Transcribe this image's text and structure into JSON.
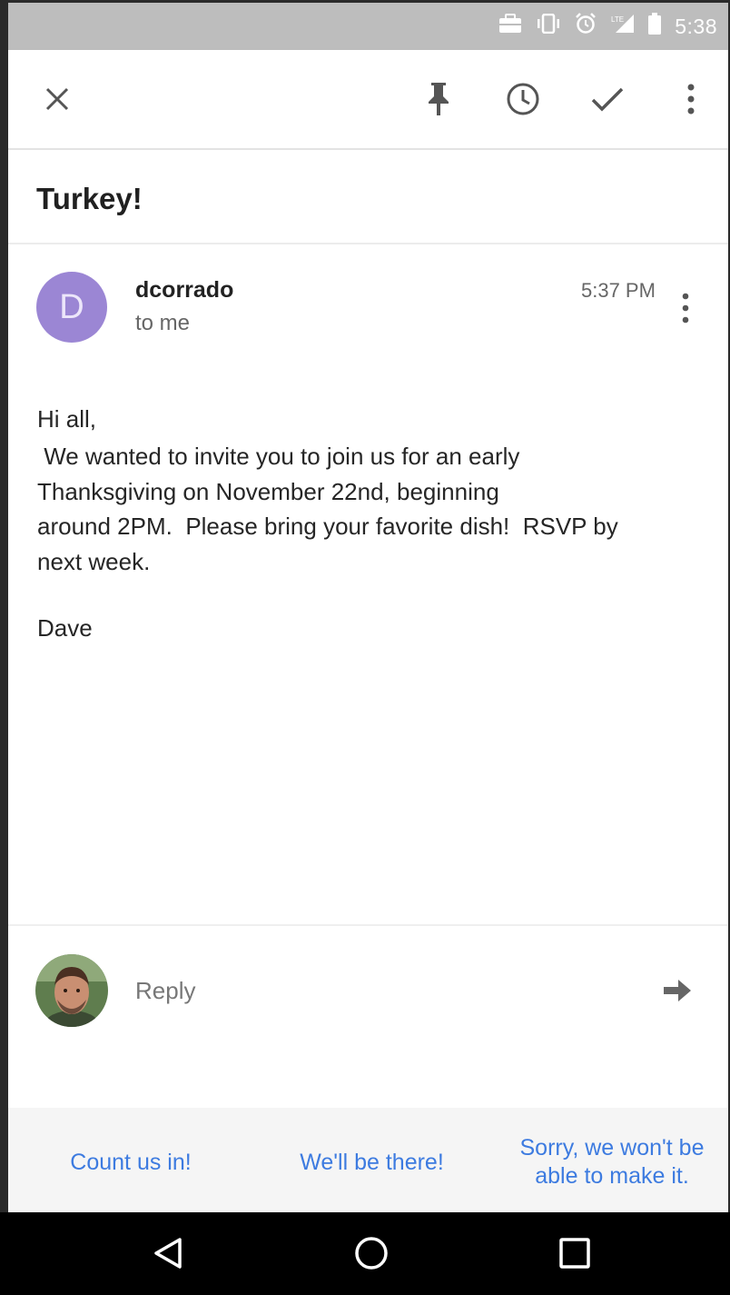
{
  "status_bar": {
    "time": "5:38",
    "icons": [
      "briefcase-icon",
      "vibrate-icon",
      "alarm-icon",
      "signal-lte-icon",
      "battery-icon"
    ]
  },
  "toolbar": {
    "icons": [
      "close-icon",
      "pin-icon",
      "snooze-icon",
      "done-icon",
      "more-vert-icon"
    ]
  },
  "email": {
    "subject": "Turkey!",
    "sender_initial": "D",
    "sender": "dcorrado",
    "recipient": "to me",
    "time": "5:37 PM",
    "greeting": "Hi all,",
    "paragraph": " We wanted to invite you to join us for an early\nThanksgiving on November 22nd, beginning\naround 2PM.  Please bring your favorite dish!  RSVP by\nnext week.",
    "signoff": "Dave"
  },
  "reply": {
    "placeholder": "Reply"
  },
  "smart_replies": [
    "Count us in!",
    "We'll be there!",
    "Sorry, we won't be able to make it."
  ],
  "nav": [
    "back-icon",
    "home-icon",
    "recents-icon"
  ],
  "colors": {
    "accent": "#3d7be0",
    "avatar": "#9b86d4",
    "status_bar": "#bdbdbd"
  }
}
